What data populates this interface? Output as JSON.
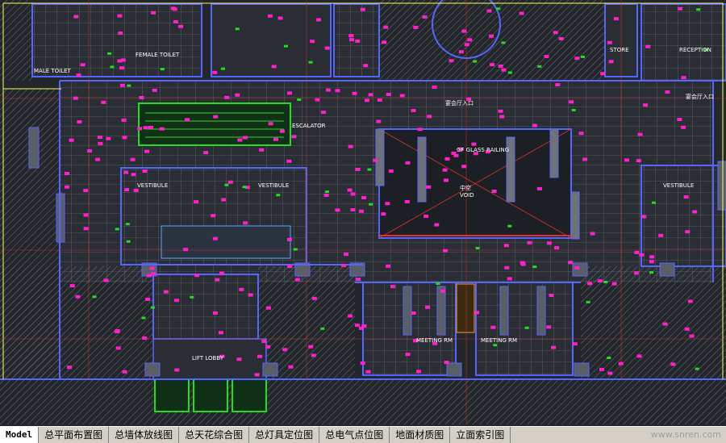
{
  "drawing": {
    "labels": {
      "female_toilet": "FEMALE TOILET",
      "male_toilet": "MALE TOILET",
      "store": "STORE",
      "reception": "RECEPTION",
      "escalator": "ESCALATOR",
      "glass_railing": "GF GLASS RAILING",
      "void_cn": "中空",
      "void_en": "VOID",
      "vestibule_left": "VESTIBULE",
      "vestibule_mid": "VESTIBULE",
      "vestibule_right": "VESTIBULE",
      "lift_lobby": "LIFT LOBBY",
      "meeting_left": "MEETING RM",
      "meeting_right": "MEETING RM",
      "entrance": "宴会厅入口",
      "corridor": "宴会厅入口"
    }
  },
  "tabs": [
    {
      "label": "Model",
      "active": true
    },
    {
      "label": "总平面布置图",
      "active": false
    },
    {
      "label": "总墙体放线图",
      "active": false
    },
    {
      "label": "总天花综合图",
      "active": false
    },
    {
      "label": "总灯具定位图",
      "active": false
    },
    {
      "label": "总电气点位图",
      "active": false
    },
    {
      "label": "地面材质图",
      "active": false
    },
    {
      "label": "立面索引图",
      "active": false
    }
  ],
  "watermark": "www.snren.com",
  "colors": {
    "background": "#23262b",
    "wall_blue": "#5566ff",
    "hatch": "#6e7278",
    "magenta": "#ff22cc",
    "yellow": "#ffff55",
    "green": "#22dd22",
    "red": "#dd3333"
  }
}
